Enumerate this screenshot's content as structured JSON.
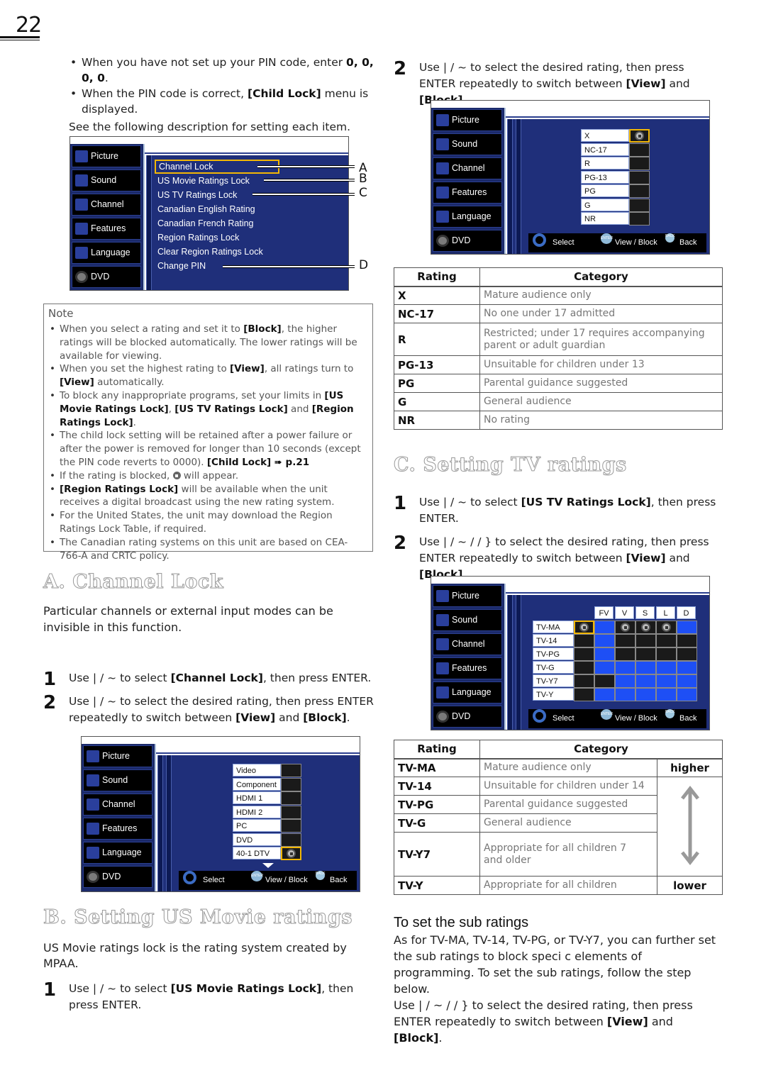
{
  "page": {
    "number": "22"
  },
  "intro": {
    "bullets": [
      {
        "text_before": "When you have not set up your PIN code, enter ",
        "bold": "0, 0, 0, 0",
        "text_after": "."
      },
      {
        "text_before": "When the PIN code is correct, ",
        "bold": "[Child Lock]",
        "text_after": " menu is displayed."
      }
    ],
    "see_following": "See the following description for setting each item."
  },
  "tv_menu_common": {
    "sidebar": [
      {
        "label": "Picture",
        "icon": "picture-icon"
      },
      {
        "label": "Sound",
        "icon": "sound-icon"
      },
      {
        "label": "Channel",
        "icon": "channel-icon"
      },
      {
        "label": "Features",
        "icon": "features-icon"
      },
      {
        "label": "Language",
        "icon": "language-icon"
      },
      {
        "label": "DVD",
        "icon": "dvd-icon"
      }
    ],
    "footer": {
      "select": "Select",
      "enter_badge": "ENTER",
      "view_block": "View / Block",
      "back_badge": "BACK",
      "back": "Back"
    }
  },
  "child_lock_menu": {
    "items": [
      "Channel Lock",
      "US Movie Ratings Lock",
      "US TV Ratings Lock",
      "Canadian English Rating",
      "Canadian French Rating",
      "Region Ratings Lock",
      "Clear Region Ratings Lock",
      "Change PIN"
    ],
    "selected": "Channel Lock",
    "callouts": [
      "A",
      "B",
      "C",
      "D"
    ]
  },
  "note": {
    "title": "Note",
    "items": [
      "When you select a rating and set it to [Block], the higher ratings will be blocked automatically. The lower ratings will be available for viewing.",
      "When you set the highest rating to [View], all ratings turn to [View] automatically.",
      "To block any inappropriate programs, set your limits in [US Movie Ratings Lock], [US TV Ratings Lock] and [Region Ratings Lock].",
      "The child lock setting will be retained after a power failure or after the power is removed for longer than 10 seconds (except the PIN code reverts to 0000). [Child Lock] ➠ p.21",
      "If the rating is blocked, (lock) will appear.",
      "[Region Ratings Lock] will be available when the unit receives a digital broadcast using the new rating system.",
      "For the United States, the unit may download the Region Ratings Lock Table, if required.",
      "The Canadian rating systems on this unit are based on CEA-766-A and CRTC policy."
    ]
  },
  "section_a": {
    "heading": "A. Channel Lock",
    "description": "Particular channels or external input modes can be invisible in this function.",
    "steps": [
      {
        "num": "1",
        "pre": "Use  | / ~  to select ",
        "bold": "[Channel Lock]",
        "post": ", then press ENTER."
      },
      {
        "num": "2",
        "pre": "Use  | / ~  to select the desired rating, then press ENTER repeatedly to switch between ",
        "bold": "[View]",
        "mid": " and ",
        "bold2": "[Block]",
        "post": "."
      }
    ],
    "menu": {
      "items": [
        {
          "label": "Video",
          "locked": false
        },
        {
          "label": "Component",
          "locked": false
        },
        {
          "label": "HDMI 1",
          "locked": false
        },
        {
          "label": "HDMI 2",
          "locked": false
        },
        {
          "label": "PC",
          "locked": false
        },
        {
          "label": "DVD",
          "locked": false
        },
        {
          "label": "40-1 DTV",
          "locked": true
        }
      ],
      "selected": "40-1 DTV"
    }
  },
  "section_b": {
    "heading": "B. Setting US Movie ratings",
    "description": "US Movie ratings lock is the rating system created by MPAA.",
    "steps": [
      {
        "num": "1",
        "pre": "Use  | / ~  to select ",
        "bold": "[US Movie Ratings Lock]",
        "post": ", then press ENTER."
      },
      {
        "num": "2",
        "pre": "Use  | / ~  to select the desired rating, then press ENTER repeatedly to switch between ",
        "bold": "[View]",
        "mid": " and ",
        "bold2": "[Block]",
        "post": "."
      }
    ],
    "menu": {
      "items": [
        {
          "label": "X",
          "locked": true
        },
        {
          "label": "NC-17",
          "locked": false
        },
        {
          "label": "R",
          "locked": false
        },
        {
          "label": "PG-13",
          "locked": false
        },
        {
          "label": "PG",
          "locked": false
        },
        {
          "label": "G",
          "locked": false
        },
        {
          "label": "NR",
          "locked": false
        }
      ],
      "selected": "X"
    },
    "table": {
      "headers": [
        "Rating",
        "Category"
      ],
      "rows": [
        [
          "X",
          "Mature audience only"
        ],
        [
          "NC-17",
          "No one under 17 admitted"
        ],
        [
          "R",
          "Restricted; under 17 requires accompanying parent or adult guardian"
        ],
        [
          "PG-13",
          "Unsuitable for children under 13"
        ],
        [
          "PG",
          "Parental guidance suggested"
        ],
        [
          "G",
          "General audience"
        ],
        [
          "NR",
          "No rating"
        ]
      ]
    }
  },
  "section_c": {
    "heading": "C. Setting TV ratings",
    "steps": [
      {
        "num": "1",
        "pre": "Use  | / ~  to select ",
        "bold": "[US TV Ratings Lock]",
        "post": ", then press ENTER."
      },
      {
        "num": "2",
        "pre": "Use  | / ~ /   / }  to select the desired rating, then press ENTER repeatedly to switch between ",
        "bold": "[View]",
        "mid": " and ",
        "bold2": "[Block]",
        "post": "."
      }
    ],
    "grid": {
      "columns": [
        "",
        "FV",
        "V",
        "S",
        "L",
        "D"
      ],
      "rows": [
        {
          "label": "TV-MA",
          "states": [
            "lock",
            "view",
            "lock",
            "lock",
            "lock",
            "view"
          ]
        },
        {
          "label": "TV-14",
          "states": [
            "off",
            "view",
            "off",
            "off",
            "off",
            "off"
          ]
        },
        {
          "label": "TV-PG",
          "states": [
            "off",
            "view",
            "off",
            "off",
            "off",
            "off"
          ]
        },
        {
          "label": "TV-G",
          "states": [
            "off",
            "view",
            "view",
            "view",
            "view",
            "view"
          ]
        },
        {
          "label": "TV-Y7",
          "states": [
            "off",
            "off",
            "view",
            "view",
            "view",
            "view"
          ]
        },
        {
          "label": "TV-Y",
          "states": [
            "off",
            "view",
            "view",
            "view",
            "view",
            "view"
          ]
        }
      ],
      "selected": "TV-MA"
    },
    "table": {
      "headers": [
        "Rating",
        "Category"
      ],
      "rows": [
        [
          "TV-MA",
          "Mature audience only"
        ],
        [
          "TV-14",
          "Unsuitable for children under 14"
        ],
        [
          "TV-PG",
          "Parental guidance suggested"
        ],
        [
          "TV-G",
          "General audience"
        ],
        [
          "TV-Y7",
          "Appropriate for all children 7 and older"
        ],
        [
          "TV-Y",
          "Appropriate for all children"
        ]
      ],
      "higher": "higher",
      "lower": "lower"
    },
    "sub_ratings": {
      "title": "To set the sub ratings",
      "body": "As for TV-MA, TV-14, TV-PG, or TV-Y7, you can further set the sub ratings to block speci c elements of programming. To set the sub ratings, follow the step below.",
      "step_pre": "Use  | / ~ /   / }  to select the desired rating, then press ENTER repeatedly to switch between ",
      "bold": "[View]",
      "mid": " and ",
      "bold2": "[Block]",
      "post": "."
    }
  }
}
